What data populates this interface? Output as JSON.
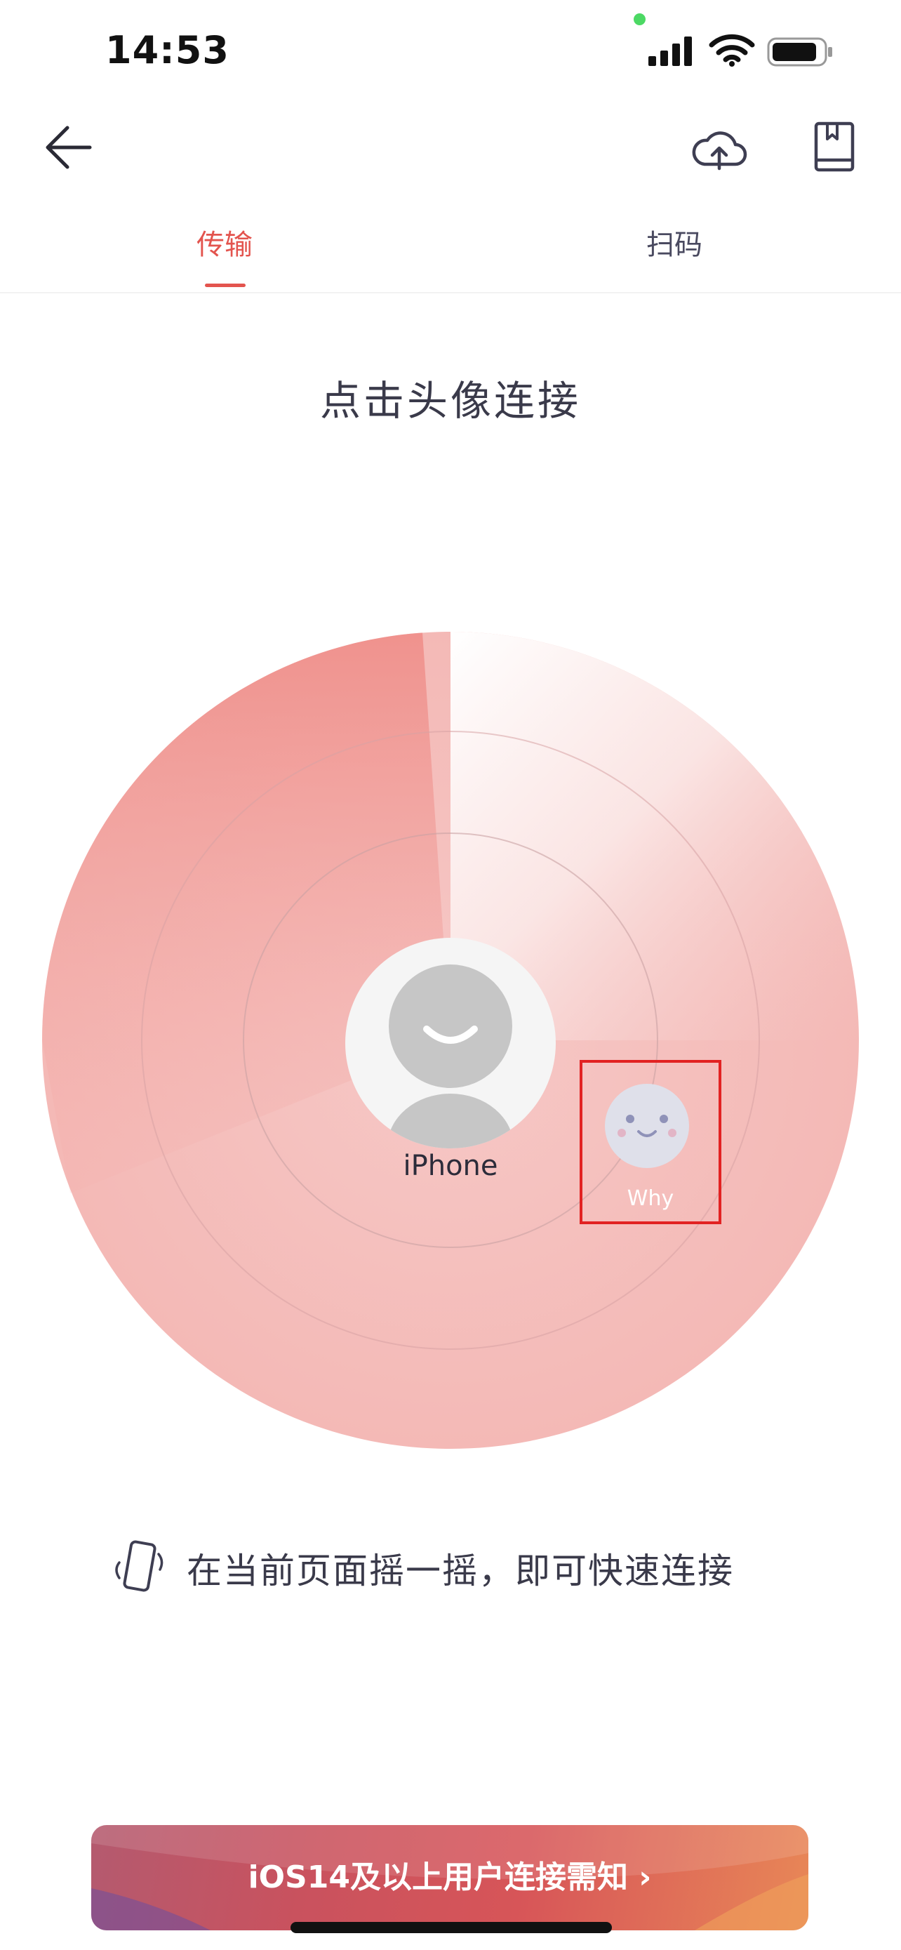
{
  "status_bar": {
    "time": "14:53"
  },
  "nav": {
    "back_icon": "arrow-left-icon",
    "cloud_icon": "cloud-upload-icon",
    "book_icon": "book-icon"
  },
  "tabs": [
    {
      "label": "传输",
      "active": true
    },
    {
      "label": "扫码",
      "active": false
    }
  ],
  "heading": "点击头像连接",
  "radar": {
    "self_label": "iPhone",
    "peers": [
      {
        "name": "Why"
      }
    ]
  },
  "shake_hint": "在当前页面摇一摇，即可快速连接",
  "banner": {
    "label": "iOS14及以上用户连接需知 ›"
  },
  "colors": {
    "accent": "#e3544e",
    "radar": "#f08c88",
    "highlight": "#e22222"
  }
}
